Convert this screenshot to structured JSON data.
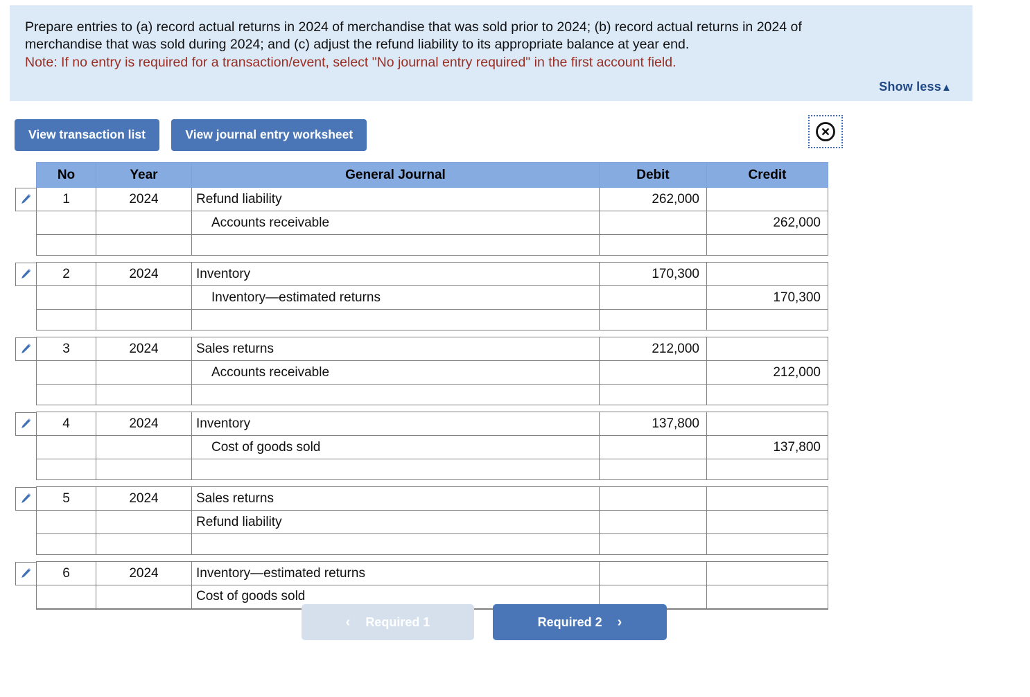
{
  "banner": {
    "instruction_line1": "Prepare entries to (a) record actual returns in 2024 of merchandise that was sold prior to 2024; (b) record actual returns in 2024 of",
    "instruction_line2": "merchandise that was sold during 2024; and (c) adjust the refund liability to its appropriate balance at year end.",
    "note": "Note: If no entry is required for a transaction/event, select \"No journal entry required\" in the first account field.",
    "show_less_label": "Show less",
    "show_less_caret": "▲",
    "note_color": "#9b2d22",
    "background_color": "#dce9f7"
  },
  "toolbar": {
    "view_transaction_list_label": "View transaction list",
    "view_journal_entry_worksheet_label": "View journal entry worksheet",
    "close_icon_name": "close-circle-icon",
    "button_color": "#4a76b8"
  },
  "table": {
    "headers": {
      "no": "No",
      "year": "Year",
      "general_journal": "General Journal",
      "debit": "Debit",
      "credit": "Credit"
    },
    "header_color": "#85abe0",
    "entries": [
      {
        "no": "1",
        "year": "2024",
        "lines": [
          {
            "account": "Refund liability",
            "indent": false,
            "debit": "262,000",
            "credit": ""
          },
          {
            "account": "Accounts receivable",
            "indent": true,
            "debit": "",
            "credit": "262,000"
          },
          {
            "account": "",
            "indent": false,
            "debit": "",
            "credit": ""
          }
        ]
      },
      {
        "no": "2",
        "year": "2024",
        "lines": [
          {
            "account": "Inventory",
            "indent": false,
            "debit": "170,300",
            "credit": ""
          },
          {
            "account": "Inventory—estimated returns",
            "indent": true,
            "debit": "",
            "credit": "170,300"
          },
          {
            "account": "",
            "indent": false,
            "debit": "",
            "credit": ""
          }
        ]
      },
      {
        "no": "3",
        "year": "2024",
        "lines": [
          {
            "account": "Sales returns",
            "indent": false,
            "debit": "212,000",
            "credit": ""
          },
          {
            "account": "Accounts receivable",
            "indent": true,
            "debit": "",
            "credit": "212,000"
          },
          {
            "account": "",
            "indent": false,
            "debit": "",
            "credit": ""
          }
        ]
      },
      {
        "no": "4",
        "year": "2024",
        "lines": [
          {
            "account": "Inventory",
            "indent": false,
            "debit": "137,800",
            "credit": ""
          },
          {
            "account": "Cost of goods sold",
            "indent": true,
            "debit": "",
            "credit": "137,800"
          },
          {
            "account": "",
            "indent": false,
            "debit": "",
            "credit": ""
          }
        ]
      },
      {
        "no": "5",
        "year": "2024",
        "lines": [
          {
            "account": "Sales returns",
            "indent": false,
            "debit": "",
            "credit": ""
          },
          {
            "account": "Refund liability",
            "indent": false,
            "debit": "",
            "credit": ""
          },
          {
            "account": "",
            "indent": false,
            "debit": "",
            "credit": ""
          }
        ]
      },
      {
        "no": "6",
        "year": "2024",
        "lines": [
          {
            "account": "Inventory—estimated returns",
            "indent": false,
            "debit": "",
            "credit": ""
          },
          {
            "account": "Cost of goods sold",
            "indent": false,
            "debit": "",
            "credit": ""
          }
        ]
      }
    ],
    "edit_icon_name": "pencil-edit-icon"
  },
  "nav": {
    "prev_label": "Required 1",
    "prev_chevron": "‹",
    "next_label": "Required 2",
    "next_chevron": "›",
    "prev_color": "#d6e0ed",
    "next_color": "#4a76b8"
  }
}
